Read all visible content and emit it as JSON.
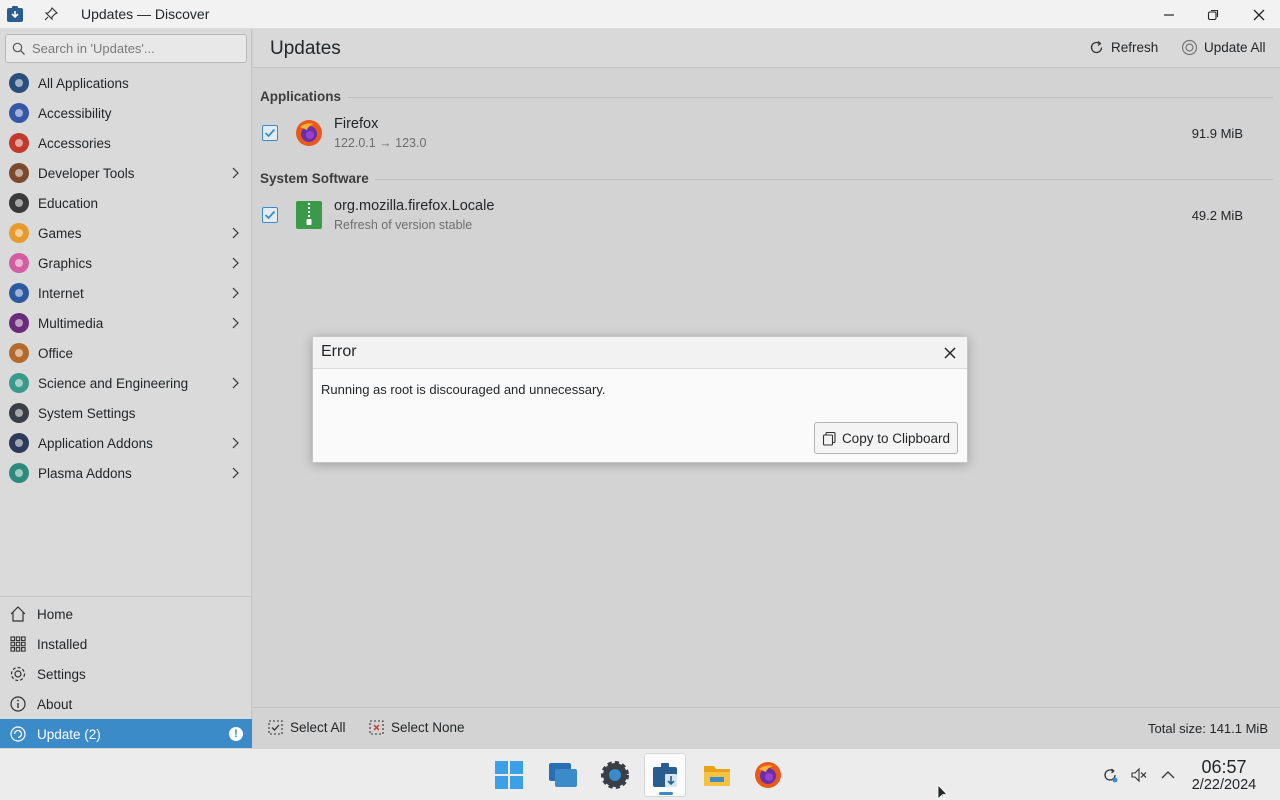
{
  "window": {
    "title": "Updates — Discover"
  },
  "sidebar": {
    "search_placeholder": "Search in 'Updates'...",
    "categories": [
      {
        "label": "All Applications",
        "icon": "all-applications-icon",
        "color": "#2a4f7c",
        "has_children": false
      },
      {
        "label": "Accessibility",
        "icon": "accessibility-icon",
        "color": "#3457a8",
        "has_children": false
      },
      {
        "label": "Accessories",
        "icon": "accessories-icon",
        "color": "#c0392b",
        "has_children": false
      },
      {
        "label": "Developer Tools",
        "icon": "developer-tools-icon",
        "color": "#7b4a2e",
        "has_children": true
      },
      {
        "label": "Education",
        "icon": "education-icon",
        "color": "#3a3a3a",
        "has_children": false
      },
      {
        "label": "Games",
        "icon": "games-icon",
        "color": "#e89a2c",
        "has_children": true
      },
      {
        "label": "Graphics",
        "icon": "graphics-icon",
        "color": "#d35da0",
        "has_children": true
      },
      {
        "label": "Internet",
        "icon": "internet-icon",
        "color": "#2b5aa0",
        "has_children": true
      },
      {
        "label": "Multimedia",
        "icon": "multimedia-icon",
        "color": "#6a2c7a",
        "has_children": true
      },
      {
        "label": "Office",
        "icon": "office-icon",
        "color": "#b36a2a",
        "has_children": false
      },
      {
        "label": "Science and Engineering",
        "icon": "science-icon",
        "color": "#3a9a8a",
        "has_children": true
      },
      {
        "label": "System Settings",
        "icon": "system-settings-icon",
        "color": "#3a3f47",
        "has_children": false
      },
      {
        "label": "Application Addons",
        "icon": "application-addons-icon",
        "color": "#2d3a5a",
        "has_children": true
      },
      {
        "label": "Plasma Addons",
        "icon": "plasma-addons-icon",
        "color": "#2e8a7a",
        "has_children": true
      }
    ],
    "nav": {
      "home": "Home",
      "installed": "Installed",
      "settings": "Settings",
      "about": "About",
      "update": "Update (2)",
      "update_badge": "!"
    },
    "accent_color": "#3b8bc8"
  },
  "main": {
    "page_title": "Updates",
    "refresh_label": "Refresh",
    "update_all_label": "Update All",
    "sections": {
      "applications": "Applications",
      "system_software": "System Software"
    },
    "updates": [
      {
        "name": "Firefox",
        "detail": "122.0.1 → 123.0",
        "size": "91.9 MiB",
        "checked": true
      },
      {
        "name": "org.mozilla.firefox.Locale",
        "detail": "Refresh of version stable",
        "size": "49.2 MiB",
        "checked": true
      }
    ],
    "footer": {
      "select_all": "Select All",
      "select_none": "Select None",
      "total_size": "Total size: 141.1 MiB"
    }
  },
  "dialog": {
    "title": "Error",
    "message": "Running as root is discouraged and unnecessary.",
    "copy_button": "Copy to Clipboard"
  },
  "taskbar": {
    "apps": [
      "start-menu-icon",
      "task-switcher-icon",
      "system-settings-icon",
      "discover-icon",
      "file-manager-icon",
      "firefox-icon"
    ],
    "active_app": "discover-icon",
    "clock_time": "06:57",
    "clock_date": "2/22/2024"
  }
}
